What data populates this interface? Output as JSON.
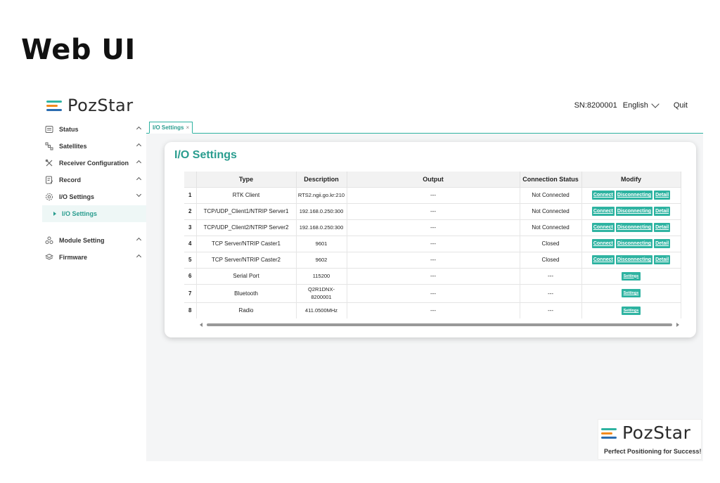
{
  "slide_title": "Web UI",
  "header": {
    "logo_text": "PozStar",
    "sn": "SN:8200001",
    "language": "English",
    "quit_label": "Quit"
  },
  "sidebar": {
    "items": [
      {
        "label": "Status"
      },
      {
        "label": "Satellites"
      },
      {
        "label": "Receiver Configuration"
      },
      {
        "label": "Record"
      },
      {
        "label": "I/O Settings"
      },
      {
        "label": "I/O Settings"
      },
      {
        "label": "Module Setting"
      },
      {
        "label": "Firmware"
      }
    ]
  },
  "tabs": [
    {
      "label": "I/O Settings",
      "close": "×"
    }
  ],
  "page": {
    "title": "I/O Settings",
    "columns": [
      "Type",
      "Description",
      "Output",
      "Connection Status",
      "Modify"
    ],
    "buttons": {
      "connect": "Connect",
      "disconnect": "Disconnecting",
      "detail": "Detail",
      "settings": "Settings"
    },
    "rows": [
      {
        "num": "1",
        "type": "RTK Client",
        "desc": "RTS2.ngii.go.kr:210",
        "output": "---",
        "status": "Not Connected"
      },
      {
        "num": "2",
        "type": "TCP/UDP_Client1/NTRIP Server1",
        "desc": "192.168.0.250:300",
        "output": "---",
        "status": "Not Connected"
      },
      {
        "num": "3",
        "type": "TCP/UDP_Client2/NTRIP Server2",
        "desc": "192.168.0.250:300",
        "output": "---",
        "status": "Not Connected"
      },
      {
        "num": "4",
        "type": "TCP Server/NTRIP Caster1",
        "desc": "9601",
        "output": "---",
        "status": "Closed"
      },
      {
        "num": "5",
        "type": "TCP Server/NTRIP Caster2",
        "desc": "9602",
        "output": "---",
        "status": "Closed"
      },
      {
        "num": "6",
        "type": "Serial Port",
        "desc": "115200",
        "output": "---",
        "status": "---"
      },
      {
        "num": "7",
        "type": "Bluetooth",
        "desc1": "Q2R1DNX-",
        "desc2": "8200001",
        "output": "---",
        "status": "---"
      },
      {
        "num": "8",
        "type": "Radio",
        "desc": "411.0500MHz",
        "output": "---",
        "status": "---"
      }
    ]
  },
  "brand": {
    "logo_text": "PozStar",
    "tagline": "Perfect Positioning for Success!"
  },
  "colors": {
    "accent": "#2eb3a1",
    "accent_text": "#2a9d8f",
    "logo_orange": "#f28a1e",
    "logo_blue": "#2b6cb0"
  }
}
